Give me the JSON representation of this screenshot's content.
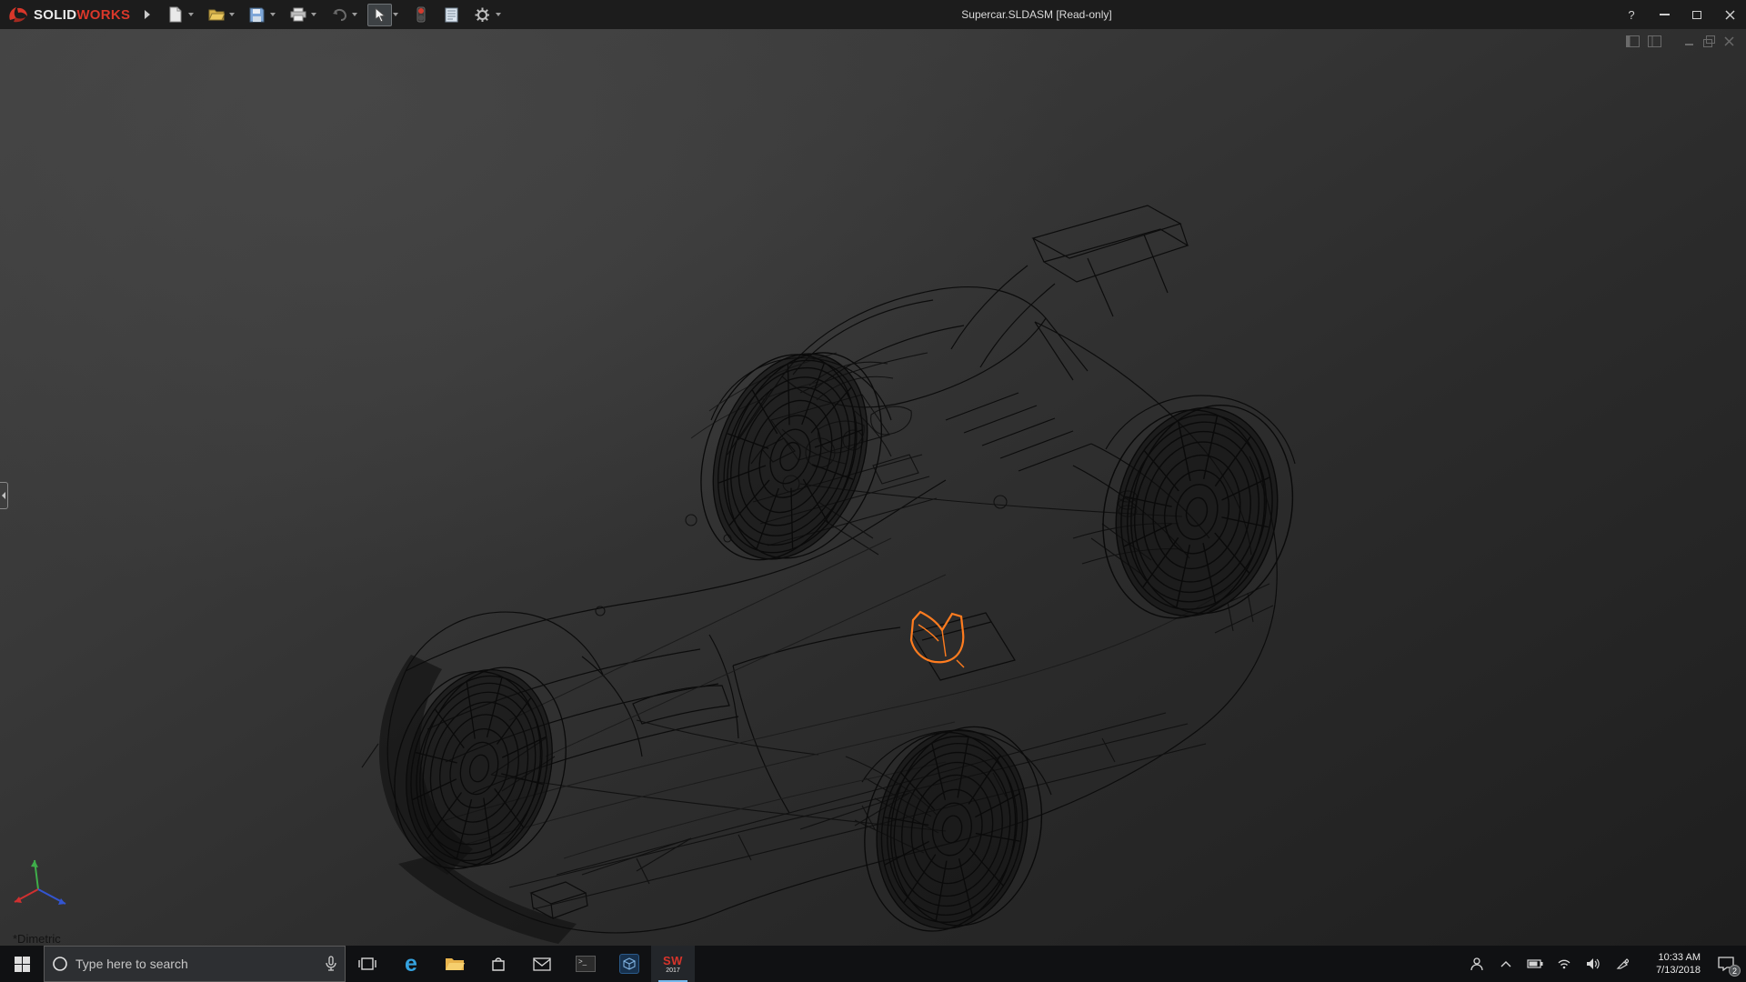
{
  "titlebar": {
    "brand_solid": "SOLID",
    "brand_works": "WORKS",
    "title": "Supercar.SLDASM [Read-only]",
    "help_glyph": "?"
  },
  "toolbar": {
    "buttons": [
      "new",
      "open",
      "save",
      "print",
      "undo",
      "select",
      "rebuild",
      "file-properties",
      "options"
    ],
    "active_button": "select"
  },
  "viewport": {
    "view_label": "*Dimetric",
    "selection_color": "#ff7c1f",
    "background_top": "#404040",
    "background_bottom": "#1e1e1e",
    "triad_colors": {
      "x": "#d03030",
      "y": "#3fae4a",
      "z": "#3355d0"
    }
  },
  "taskbar": {
    "search_placeholder": "Type here to search",
    "edge_glyph": "e",
    "console_glyph": ">_",
    "sw_icon_top": "SW",
    "sw_icon_year": "2017",
    "clock_time": "10:33 AM",
    "clock_date": "7/13/2018",
    "notification_count": "2"
  }
}
